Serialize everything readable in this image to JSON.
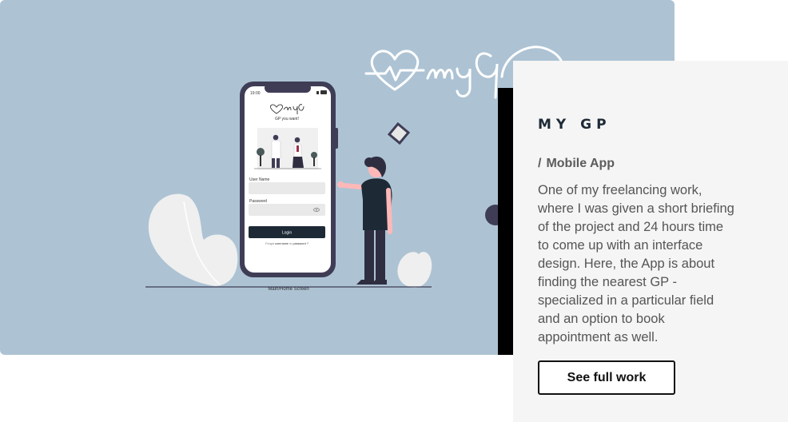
{
  "project": {
    "title": "MY GP",
    "category_prefix": "/",
    "category": "Mobile App",
    "description": "One of my freelancing work, where I was given a short briefing of the project and 24 hours time to come up with an interface design. Here, the App is about finding the nearest GP - specialized in a particular field and an option to book appointment as well.",
    "button_label": "See full work"
  },
  "mockup": {
    "status_time": "19:00",
    "tagline": "GP you want!",
    "username_label": "User Name",
    "password_label": "Password",
    "login_label": "Login",
    "forgot_prefix": "Forgot",
    "forgot_username": "username",
    "forgot_or": "or",
    "forgot_password": "password ?",
    "caption": "Main/Home Screen"
  },
  "colors": {
    "hero_bg": "#adc3d4",
    "card_bg": "#f5f5f5",
    "dark_navy": "#1d2a36",
    "phone_frame": "#3f3d56"
  }
}
